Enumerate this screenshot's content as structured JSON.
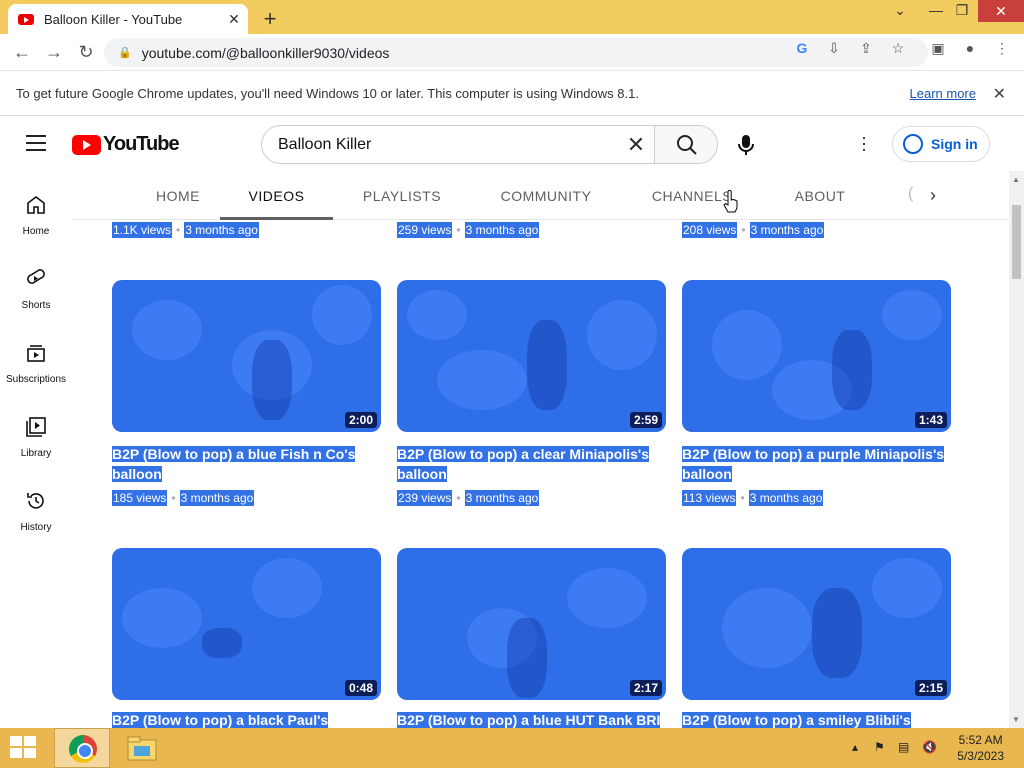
{
  "browser": {
    "tab_title": "Balloon Killer - YouTube",
    "new_tab_label": "+",
    "url": "youtube.com/@balloonkiller9030/videos",
    "infobar_text": "To get future Google Chrome updates, you'll need Windows 10 or later. This computer is using Windows 8.1.",
    "infobar_link": "Learn more"
  },
  "youtube": {
    "logo_text": "YouTube",
    "search_value": "Balloon Killer",
    "sign_in_label": "Sign in",
    "guide": [
      {
        "label": "Home",
        "icon": "home-icon"
      },
      {
        "label": "Shorts",
        "icon": "shorts-icon"
      },
      {
        "label": "Subscriptions",
        "icon": "subscriptions-icon"
      },
      {
        "label": "Library",
        "icon": "library-icon"
      },
      {
        "label": "History",
        "icon": "history-icon"
      }
    ],
    "channel_tabs": [
      "HOME",
      "VIDEOS",
      "PLAYLISTS",
      "COMMUNITY",
      "CHANNELS",
      "ABOUT"
    ],
    "active_tab": "VIDEOS",
    "top_row_meta": [
      {
        "views": "1.1K views",
        "age": "3 months ago"
      },
      {
        "views": "259 views",
        "age": "3 months ago"
      },
      {
        "views": "208 views",
        "age": "3 months ago"
      }
    ],
    "videos_row1": [
      {
        "duration": "2:00",
        "title_line1": "B2P (Blow to pop) a blue Fish n Co's",
        "title_line2": "balloon",
        "views": "185 views",
        "age": "3 months ago"
      },
      {
        "duration": "2:59",
        "title_line1": "B2P (Blow to pop) a clear Miniapolis's",
        "title_line2": "balloon",
        "views": "239 views",
        "age": "3 months ago"
      },
      {
        "duration": "1:43",
        "title_line1": "B2P (Blow to pop) a purple Miniapolis's",
        "title_line2": "balloon",
        "views": "113 views",
        "age": "3 months ago"
      }
    ],
    "videos_row2": [
      {
        "duration": "0:48",
        "title_line1": "B2P (Blow to pop) a black Paul's"
      },
      {
        "duration": "2:17",
        "title_line1": "B2P (Blow to pop) a blue HUT Bank BRI"
      },
      {
        "duration": "2:15",
        "title_line1": "B2P (Blow to pop) a smiley Blibli's"
      }
    ],
    "meta_separator": "•"
  },
  "taskbar": {
    "time": "5:52 AM",
    "date": "5/3/2023"
  },
  "colors": {
    "selection": "#3271e6",
    "titlebar": "#f2cc5e",
    "taskbar": "#e8b74f",
    "youtube_red": "#ff0000",
    "link_blue": "#065fd4"
  }
}
